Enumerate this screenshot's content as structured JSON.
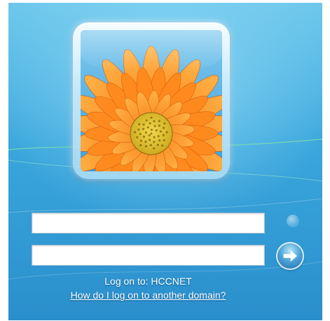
{
  "login": {
    "username_value": "",
    "password_value": "",
    "logon_to_text": "Log on to: HCCNET",
    "domain_help_link": "How do I log on to another domain?"
  },
  "icons": {
    "submit": "arrow-right-icon",
    "user_tile": "user-tile-flower-image"
  },
  "colors": {
    "background_top": "#6ec8ec",
    "background_bottom": "#2a8fcc",
    "flower_petal": "#f57a12",
    "flower_center": "#c9a61c"
  }
}
